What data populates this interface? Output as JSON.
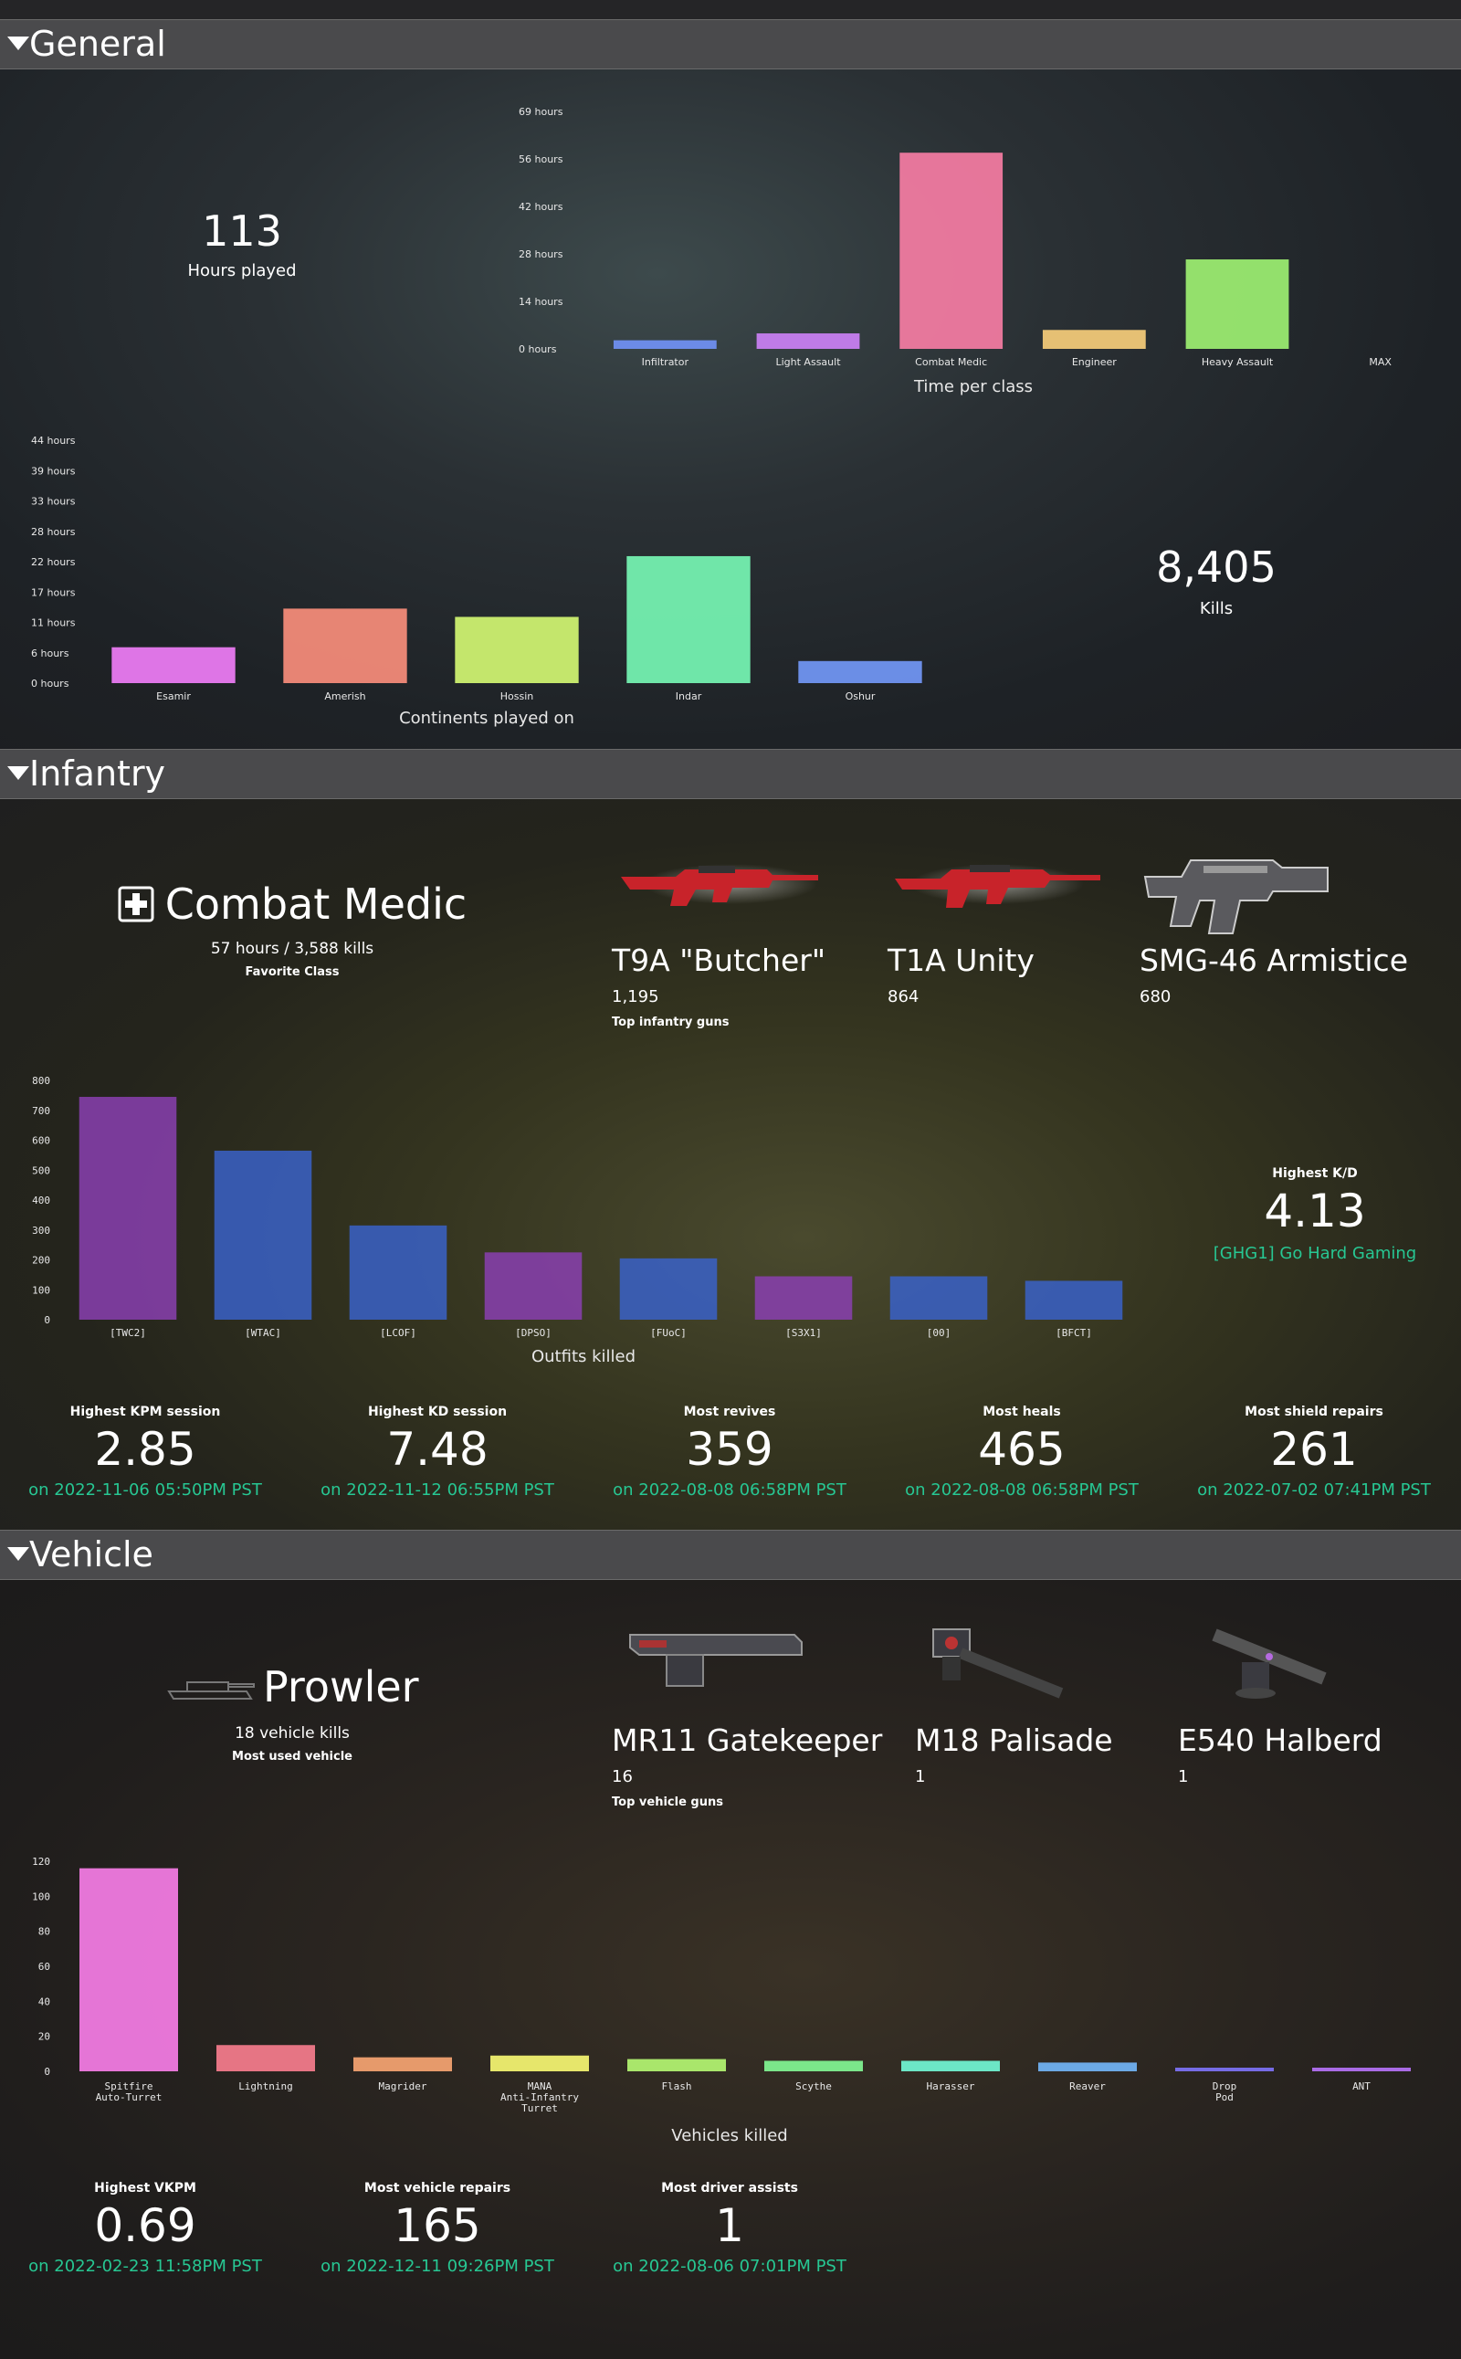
{
  "sections": {
    "general": "General",
    "infantry": "Infantry",
    "vehicle": "Vehicle"
  },
  "general": {
    "hours_played_value": "113",
    "hours_played_label": "Hours played",
    "kills_value": "8,405",
    "kills_label": "Kills",
    "time_per_class": {
      "title": "Time per class",
      "y_ticks": [
        "69 hours",
        "56 hours",
        "42 hours",
        "28 hours",
        "14 hours",
        "0 hours"
      ]
    },
    "continents": {
      "title": "Continents played on",
      "y_ticks": [
        "44 hours",
        "39 hours",
        "33 hours",
        "28 hours",
        "22 hours",
        "17 hours",
        "11 hours",
        "6 hours",
        "0 hours"
      ]
    }
  },
  "infantry": {
    "favorite_class_name": "Combat Medic",
    "favorite_class_detail": "57 hours / 3,588 kills",
    "favorite_class_label": "Favorite Class",
    "top_guns_label": "Top infantry guns",
    "guns": [
      {
        "name": "T9A \"Butcher\"",
        "kills": "1,195"
      },
      {
        "name": "T1A Unity",
        "kills": "864"
      },
      {
        "name": "SMG-46 Armistice",
        "kills": "680"
      }
    ],
    "highest_kd_label": "Highest K/D",
    "highest_kd_value": "4.13",
    "highest_kd_outfit": "[GHG1] Go Hard Gaming",
    "outfits_chart": {
      "title": "Outfits killed",
      "y_ticks": [
        "800",
        "700",
        "600",
        "500",
        "400",
        "300",
        "200",
        "100",
        "0"
      ]
    },
    "stats": [
      {
        "title": "Highest KPM session",
        "value": "2.85",
        "date": "on 2022-11-06 05:50PM PST"
      },
      {
        "title": "Highest KD session",
        "value": "7.48",
        "date": "on 2022-11-12 06:55PM PST"
      },
      {
        "title": "Most revives",
        "value": "359",
        "date": "on 2022-08-08 06:58PM PST"
      },
      {
        "title": "Most heals",
        "value": "465",
        "date": "on 2022-08-08 06:58PM PST"
      },
      {
        "title": "Most shield repairs",
        "value": "261",
        "date": "on 2022-07-02 07:41PM PST"
      }
    ]
  },
  "vehicle": {
    "most_used_name": "Prowler",
    "most_used_detail": "18 vehicle kills",
    "most_used_label": "Most used vehicle",
    "top_guns_label": "Top vehicle guns",
    "guns": [
      {
        "name": "MR11 Gatekeeper",
        "kills": "16"
      },
      {
        "name": "M18 Palisade",
        "kills": "1"
      },
      {
        "name": "E540 Halberd",
        "kills": "1"
      }
    ],
    "vehicles_chart": {
      "title": "Vehicles killed",
      "y_ticks": [
        "120",
        "100",
        "80",
        "60",
        "40",
        "20",
        "0"
      ]
    },
    "stats": [
      {
        "title": "Highest VKPM",
        "value": "0.69",
        "date": "on 2022-02-23 11:58PM PST"
      },
      {
        "title": "Most vehicle repairs",
        "value": "165",
        "date": "on 2022-12-11 09:26PM PST"
      },
      {
        "title": "Most driver assists",
        "value": "1",
        "date": "on 2022-08-06 07:01PM PST"
      }
    ]
  },
  "chart_data": [
    {
      "type": "bar",
      "title": "Time per class",
      "categories": [
        "Infiltrator",
        "Light Assault",
        "Combat Medic",
        "Engineer",
        "Heavy Assault",
        "MAX"
      ],
      "values": [
        2.5,
        4.5,
        57,
        5.5,
        26,
        0
      ],
      "ylim": [
        0,
        69
      ],
      "unit": "hours",
      "colors": [
        "#6f8ff0",
        "#c77ef0",
        "#f07aa0",
        "#f0c878",
        "#9aea70",
        "#888888"
      ]
    },
    {
      "type": "bar",
      "title": "Continents played on",
      "categories": [
        "Esamir",
        "Amerish",
        "Hossin",
        "Indar",
        "Oshur"
      ],
      "values": [
        6.5,
        13.5,
        12,
        23,
        4
      ],
      "ylim": [
        0,
        44
      ],
      "unit": "hours",
      "colors": [
        "#e97af0",
        "#f28a78",
        "#cef070",
        "#74f0b0",
        "#7093f0"
      ]
    },
    {
      "type": "bar",
      "title": "Outfits killed",
      "categories": [
        "[TWC2]",
        "[WTAC]",
        "[LCOF]",
        "[DPSO]",
        "[FUoC]",
        "[S3X1]",
        "[00]",
        "[BFCT]"
      ],
      "values": [
        745,
        565,
        315,
        225,
        205,
        145,
        145,
        130
      ],
      "ylim": [
        0,
        800
      ],
      "colors": [
        "#8a3fb0",
        "#3a62c8",
        "#3a62c8",
        "#8a3fb0",
        "#3a62c8",
        "#8a3fb0",
        "#3a62c8",
        "#3a62c8"
      ]
    },
    {
      "type": "bar",
      "title": "Vehicles killed",
      "categories": [
        "Spitfire\nAuto-Turret",
        "Lightning",
        "Magrider",
        "MANA\nAnti-Infantry\nTurret",
        "Flash",
        "Scythe",
        "Harasser",
        "Reaver",
        "Drop\nPod",
        "ANT"
      ],
      "values": [
        116,
        15,
        8,
        9,
        7,
        6,
        6,
        5,
        2,
        2
      ],
      "ylim": [
        0,
        120
      ],
      "colors": [
        "#f07ae0",
        "#f07a8a",
        "#f0a070",
        "#f0f070",
        "#b0f070",
        "#80f090",
        "#70f0d0",
        "#70b0f0",
        "#7a70f0",
        "#b070f0"
      ]
    }
  ]
}
